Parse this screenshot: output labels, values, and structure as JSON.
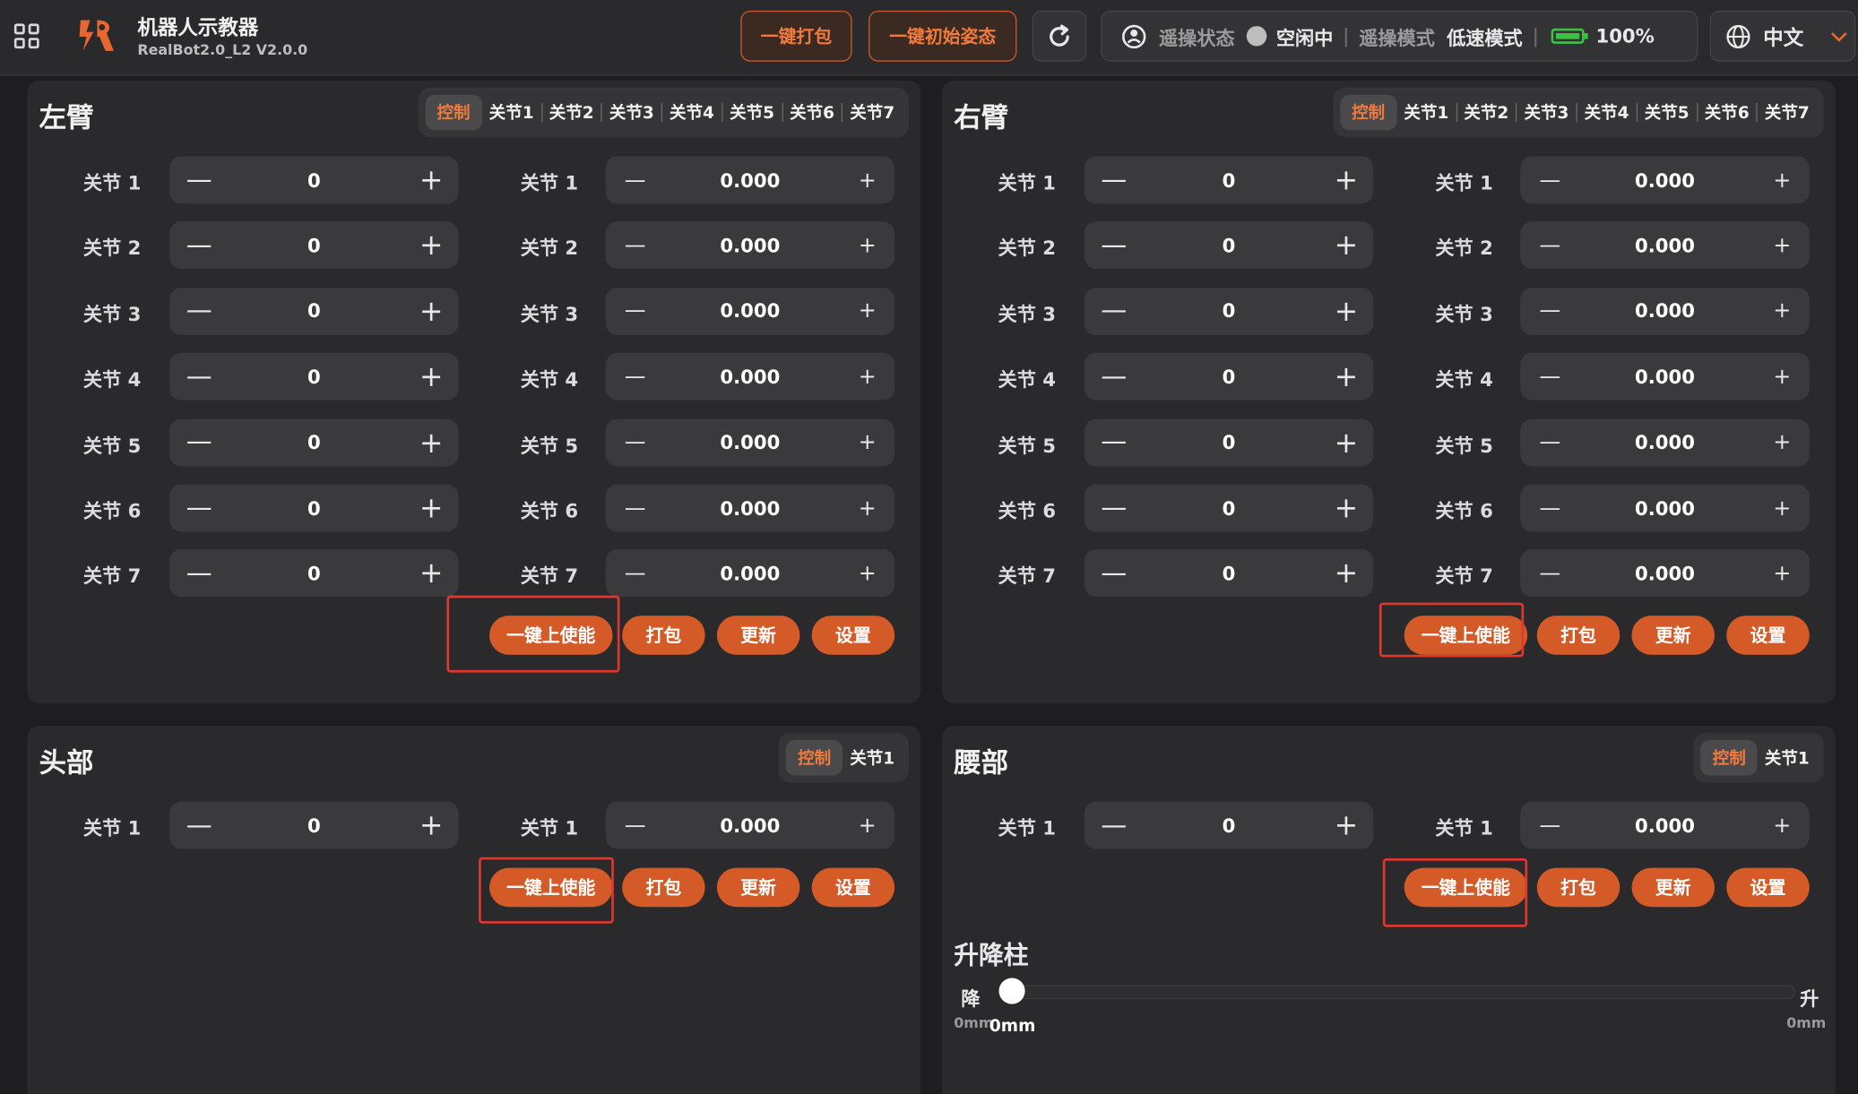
{
  "header": {
    "title": "机器人示教器",
    "subtitle": "RealBot2.0_L2 V2.0.0",
    "btn_pack": "一键打包",
    "btn_init": "一键初始姿态",
    "status_label": "遥操状态",
    "status_value": "空闲中",
    "mode_label": "遥操模式",
    "mode_value": "低速模式",
    "battery": "100%",
    "language": "中文"
  },
  "tab_control": "控制",
  "joint_tab_labels": [
    "关节1",
    "关节2",
    "关节3",
    "关节4",
    "关节5",
    "关节6",
    "关节7"
  ],
  "joint_labels": [
    "关节 1",
    "关节 2",
    "关节 3",
    "关节 4",
    "关节 5",
    "关节 6",
    "关节 7"
  ],
  "step_value": "0",
  "pos_value": "0.000",
  "buttons": {
    "enable": "一键上使能",
    "pack": "打包",
    "update": "更新",
    "settings": "设置"
  },
  "panels": {
    "left_arm": "左臂",
    "right_arm": "右臂",
    "head": "头部",
    "waist": "腰部"
  },
  "lift": {
    "title": "升降柱",
    "down": "降",
    "up": "升",
    "min_label": "0mm",
    "max_label": "0mm",
    "current": "0mm",
    "level": 0
  },
  "colors": {
    "accent": "#d45a27",
    "highlight": "#e0382f",
    "battery": "#3cc243"
  }
}
